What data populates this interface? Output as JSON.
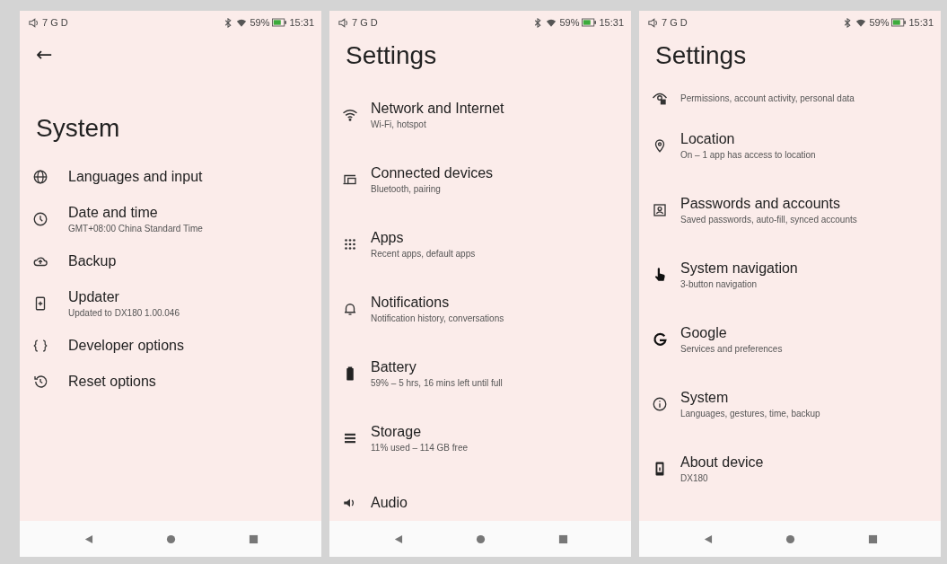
{
  "screens": [
    {
      "status_bar": {
        "left": "7 G D",
        "battery": "59%",
        "time": "15:31"
      },
      "back_button": "←",
      "title": "System",
      "items": [
        {
          "kind": "globe",
          "title": "Languages and input"
        },
        {
          "kind": "clock",
          "title": "Date and time",
          "subtitle": "GMT+08:00 China Standard Time"
        },
        {
          "kind": "cloud",
          "title": "Backup"
        },
        {
          "kind": "update",
          "title": "Updater",
          "subtitle": "Updated to DX180 1.00.046"
        },
        {
          "kind": "braces",
          "title": "Developer options"
        },
        {
          "kind": "reset",
          "title": "Reset options"
        }
      ]
    },
    {
      "status_bar": {
        "left": "7 G D",
        "battery": "59%",
        "time": "15:31"
      },
      "title": "Settings",
      "items": [
        {
          "kind": "wifi",
          "title": "Network and Internet",
          "subtitle": "Wi-Fi, hotspot"
        },
        {
          "kind": "devices",
          "title": "Connected devices",
          "subtitle": "Bluetooth, pairing"
        },
        {
          "kind": "apps",
          "title": "Apps",
          "subtitle": "Recent apps, default apps"
        },
        {
          "kind": "bell",
          "title": "Notifications",
          "subtitle": "Notification history, conversations"
        },
        {
          "kind": "battery",
          "title": "Battery",
          "subtitle": "59% – 5 hrs, 16 mins left until full"
        },
        {
          "kind": "storage",
          "title": "Storage",
          "subtitle": "11% used – 114 GB free"
        },
        {
          "kind": "speaker",
          "title": "Audio"
        }
      ]
    },
    {
      "status_bar": {
        "left": "7 G D",
        "battery": "59%",
        "time": "15:31"
      },
      "title": "Settings",
      "items": [
        {
          "kind": "privacy",
          "subtitle": "Permissions, account activity, personal data"
        },
        {
          "kind": "location",
          "title": "Location",
          "subtitle": "On – 1 app has access to location"
        },
        {
          "kind": "account",
          "title": "Passwords and accounts",
          "subtitle": "Saved passwords, auto-fill, synced accounts"
        },
        {
          "kind": "hand",
          "title": "System navigation",
          "subtitle": "3-button navigation"
        },
        {
          "kind": "google",
          "title": "Google",
          "subtitle": "Services and preferences"
        },
        {
          "kind": "info",
          "title": "System",
          "subtitle": "Languages, gestures, time, backup"
        },
        {
          "kind": "phone",
          "title": "About device",
          "subtitle": "DX180"
        }
      ]
    }
  ]
}
